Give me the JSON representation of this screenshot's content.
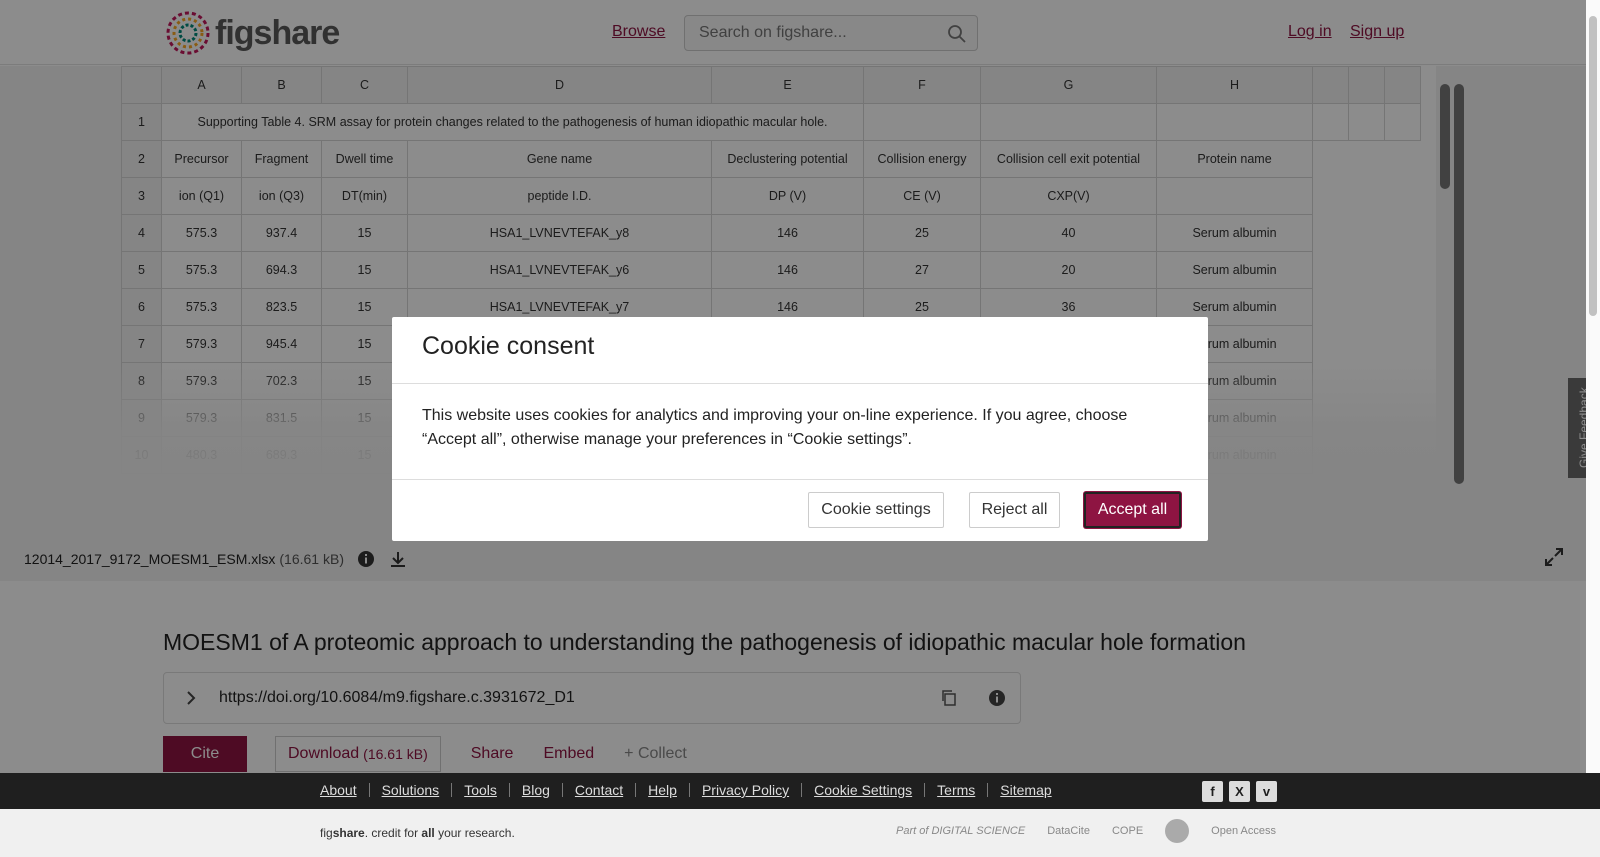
{
  "header": {
    "logo_text": "figshare",
    "browse_label": "Browse",
    "search_placeholder": "Search on figshare...",
    "login_label": "Log in",
    "signup_label": "Sign up"
  },
  "spreadsheet": {
    "column_headers": [
      "A",
      "B",
      "C",
      "D",
      "E",
      "F",
      "G",
      "H"
    ],
    "title_row": {
      "num": "1",
      "text": "Supporting Table 4. SRM assay for protein changes related to the pathogenesis of human idiopathic macular hole."
    },
    "rows": [
      {
        "num": "2",
        "cells": [
          "Precursor",
          "Fragment",
          "Dwell time",
          "Gene name",
          "Declustering potential",
          "Collision energy",
          "Collision cell exit potential",
          "Protein name"
        ]
      },
      {
        "num": "3",
        "cells": [
          "ion (Q1)",
          "ion (Q3)",
          "DT(min)",
          "peptide I.D.",
          "DP (V)",
          "CE (V)",
          "CXP(V)",
          ""
        ]
      },
      {
        "num": "4",
        "cells": [
          "575.3",
          "937.4",
          "15",
          "HSA1_LVNEVTEFAK_y8",
          "146",
          "25",
          "40",
          "Serum albumin"
        ]
      },
      {
        "num": "5",
        "cells": [
          "575.3",
          "694.3",
          "15",
          "HSA1_LVNEVTEFAK_y6",
          "146",
          "27",
          "20",
          "Serum albumin"
        ]
      },
      {
        "num": "6",
        "cells": [
          "575.3",
          "823.5",
          "15",
          "HSA1_LVNEVTEFAK_y7",
          "146",
          "25",
          "36",
          "Serum albumin"
        ]
      },
      {
        "num": "7",
        "cells": [
          "579.3",
          "945.4",
          "15",
          "",
          "",
          "",
          "",
          "Serum albumin"
        ]
      },
      {
        "num": "8",
        "cells": [
          "579.3",
          "702.3",
          "15",
          "",
          "",
          "",
          "",
          "Serum albumin"
        ]
      },
      {
        "num": "9",
        "cells": [
          "579.3",
          "831.5",
          "15",
          "",
          "",
          "",
          "",
          "Serum albumin"
        ]
      },
      {
        "num": "10",
        "cells": [
          "480.3",
          "689.3",
          "15",
          "",
          "",
          "",
          "",
          "Serum albumin"
        ]
      }
    ]
  },
  "file": {
    "name": "12014_2017_9172_MOESM1_ESM.xlsx",
    "size": "(16.61 kB)"
  },
  "feedback_label": "Give Feedback",
  "article": {
    "title": "MOESM1 of A proteomic approach to understanding the pathogenesis of idiopathic macular hole formation",
    "doi": "https://doi.org/10.6084/m9.figshare.c.3931672_D1",
    "cite_label": "Cite",
    "download_label": "Download",
    "download_size": "(16.61 kB)",
    "share_label": "Share",
    "embed_label": "Embed",
    "collect_label": "+ Collect"
  },
  "footer": {
    "links": [
      "About",
      "Solutions",
      "Tools",
      "Blog",
      "Contact",
      "Help",
      "Privacy Policy",
      "Cookie Settings",
      "Terms",
      "Sitemap"
    ],
    "tagline_pre": "fig",
    "tagline_brand": "share",
    "tagline_mid": ". credit for ",
    "tagline_all": "all",
    "tagline_post": " your research.",
    "partners": [
      "Part of DIGITAL SCIENCE",
      "DataCite",
      "COPE",
      "Open Access"
    ]
  },
  "cookie_modal": {
    "title": "Cookie consent",
    "body": "This website uses cookies for analytics and improving your on-line experience. If you agree, choose “Accept all”, otherwise manage your preferences in “Cookie settings”.",
    "settings_label": "Cookie settings",
    "reject_label": "Reject all",
    "accept_label": "Accept all"
  },
  "colors": {
    "brand": "#8e1442",
    "overlay": "rgba(0,0,0,0.45)",
    "footer_dark": "#1f1f1f"
  }
}
